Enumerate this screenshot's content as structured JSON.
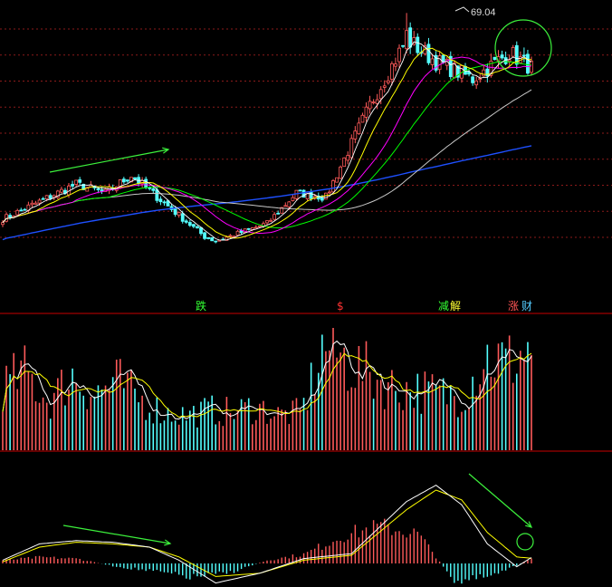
{
  "price_panel": {
    "peak_label": "69.04",
    "gridlines": 9,
    "ma_colors": {
      "ma5": "#ffffff",
      "ma10": "#ffff00",
      "ma20": "#ff00ff",
      "ma30": "#00ff00",
      "ma60": "#c8c8c8",
      "ma120": "#1e50ff"
    }
  },
  "signal_tags": [
    {
      "text": "跌",
      "color": "#33ff33"
    },
    {
      "text": "$",
      "color": "#ff3333"
    },
    {
      "text": "减",
      "color": "#33ff33"
    },
    {
      "text": "解",
      "color": "#ffff33"
    },
    {
      "text": "涨",
      "color": "#ff5555"
    },
    {
      "text": "财",
      "color": "#55ccff"
    }
  ],
  "colors": {
    "background": "#000000",
    "grid": "#8b1a1a",
    "panel_divider": "#c80000",
    "up": "#ff5a5a",
    "down": "#54ffff",
    "annotation": "#3cf03c"
  },
  "chart_data": [
    {
      "type": "candlestick",
      "title": "",
      "x": "bar index (≈145 daily bars)",
      "close_series": {
        "x": [
          0,
          10,
          20,
          28,
          35,
          45,
          55,
          58,
          65,
          72,
          80,
          88,
          100,
          110,
          118,
          128,
          138,
          145
        ],
        "y": [
          22,
          26,
          30,
          28,
          32,
          25,
          18,
          17,
          19,
          21,
          28,
          27,
          48,
          63,
          58,
          54,
          60,
          56
        ]
      },
      "peak": 69.04,
      "moving_averages": [
        "MA5",
        "MA10",
        "MA20",
        "MA30",
        "MA60",
        "MA120"
      ]
    },
    {
      "type": "bar",
      "title": "",
      "series": [
        {
          "values": [
            50,
            62,
            38,
            60,
            45,
            55,
            40,
            30,
            28,
            32,
            30,
            35,
            28,
            30,
            85,
            70,
            60,
            50,
            48,
            45,
            44,
            75,
            70,
            82
          ]
        }
      ]
    },
    {
      "type": "line",
      "title": "",
      "macd_histogram": [
        0.2,
        0.4,
        0.3,
        -0.2,
        -0.5,
        -0.9,
        -0.6,
        0.2,
        0.6,
        1.8,
        2.4,
        1.9,
        -1.2,
        -0.8,
        0.3
      ],
      "dif": {
        "x": [
          0,
          10,
          20,
          30,
          40,
          48,
          58,
          70,
          82,
          95,
          110,
          118,
          125,
          132,
          140,
          145
        ],
        "y": [
          0.2,
          1.2,
          1.4,
          1.3,
          1.0,
          0.2,
          -1.2,
          -0.6,
          0.3,
          0.6,
          3.8,
          4.8,
          3.6,
          1.2,
          -0.2,
          0.5
        ]
      },
      "dea": {
        "x": [
          0,
          10,
          20,
          30,
          40,
          48,
          58,
          70,
          82,
          95,
          110,
          118,
          125,
          132,
          140,
          145
        ],
        "y": [
          0.1,
          1.0,
          1.3,
          1.2,
          1.0,
          0.4,
          -0.8,
          -0.6,
          0.2,
          0.5,
          3.3,
          4.5,
          3.9,
          1.9,
          0.4,
          0.3
        ]
      }
    }
  ]
}
